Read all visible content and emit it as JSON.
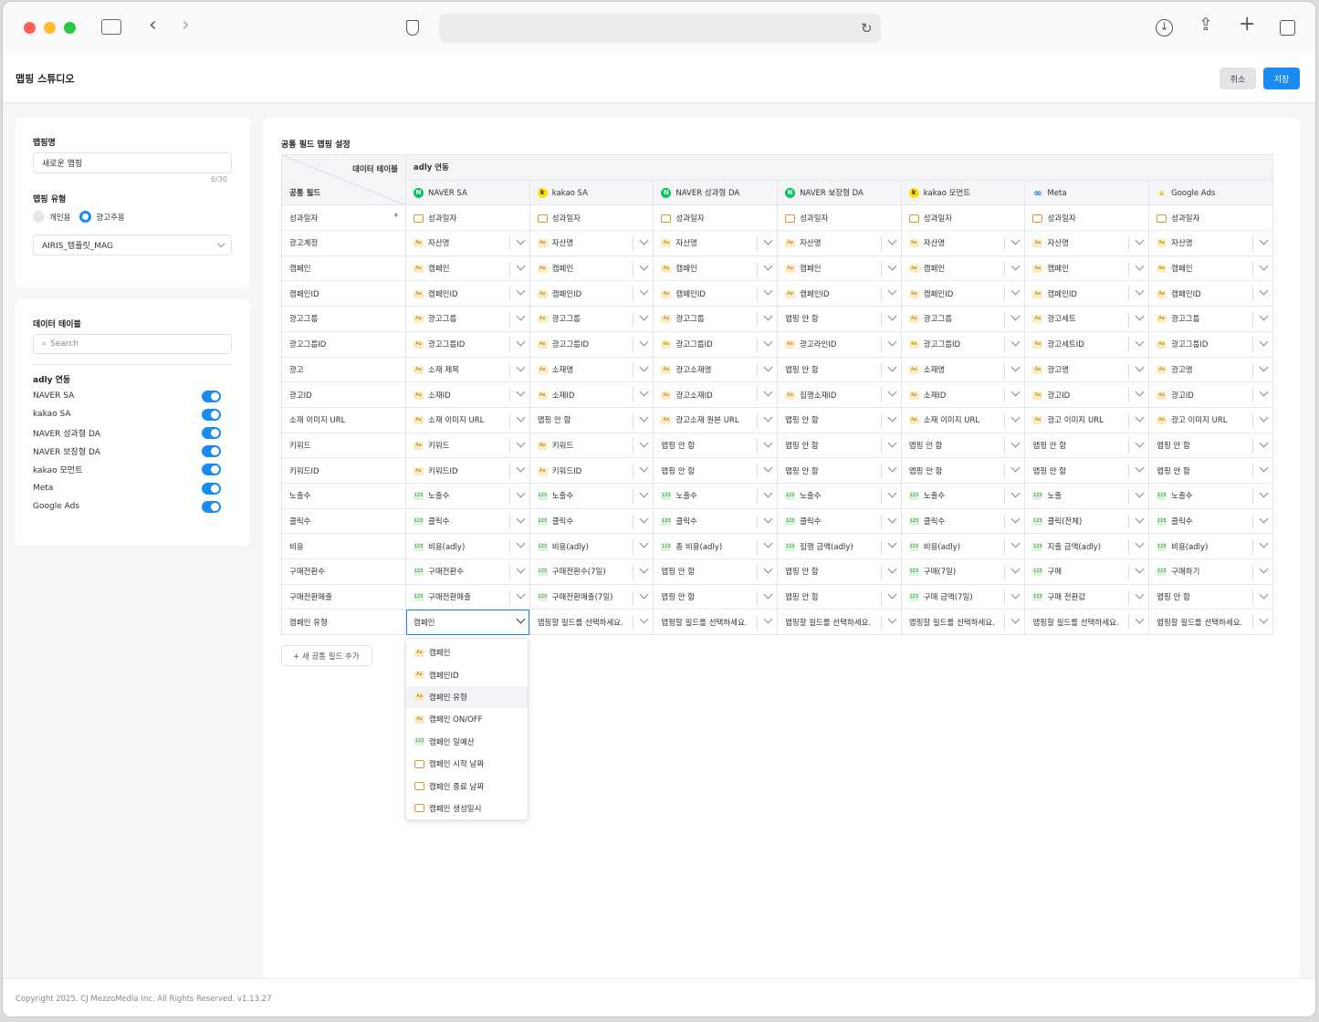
{
  "app": {
    "title": "맵핑 스튜디오",
    "cancel_label": "취소",
    "save_label": "저장",
    "footer": "Copyright 2025. CJ MezzoMedia Inc. All Rights Reserved. v1.13.27"
  },
  "colors": {
    "accent": "#1a8cf0",
    "panel_bg": "#ffffff",
    "page_bg": "#f5f6f8"
  },
  "mapping_panel": {
    "name_label": "맵핑명",
    "name_value": "새로운 맵핑",
    "char_count": "6/30",
    "type_label": "맵핑 유형",
    "type_options": [
      "개인용",
      "광고주용"
    ],
    "type_selected": "광고주용",
    "advertiser_value": "AIRIS_템플릿_MAG"
  },
  "data_table_panel": {
    "label": "데이터 테이블",
    "search_placeholder": "Search",
    "group_label": "adly 연동",
    "sources": [
      {
        "name": "NAVER SA",
        "enabled": true
      },
      {
        "name": "kakao SA",
        "enabled": true
      },
      {
        "name": "NAVER 성과형 DA",
        "enabled": true
      },
      {
        "name": "NAVER 보장형 DA",
        "enabled": true
      },
      {
        "name": "kakao 모먼트",
        "enabled": true
      },
      {
        "name": "Meta",
        "enabled": true
      },
      {
        "name": "Google Ads",
        "enabled": true
      }
    ]
  },
  "main": {
    "section_title": "공통 필드 맵핑 설정",
    "corner_top": "데이터 테이블",
    "corner_bottom": "공통 필드",
    "group_header": "adly 연동",
    "columns": [
      {
        "name": "NAVER SA",
        "icon": "naver-logo-icon"
      },
      {
        "name": "kakao SA",
        "icon": "kakao-logo-icon"
      },
      {
        "name": "NAVER 성과형 DA",
        "icon": "naver-logo-icon"
      },
      {
        "name": "NAVER 보장형 DA",
        "icon": "naver-logo-icon"
      },
      {
        "name": "kakao 모먼트",
        "icon": "kakao-logo-icon"
      },
      {
        "name": "Meta",
        "icon": "meta-logo-icon"
      },
      {
        "name": "Google Ads",
        "icon": "google-ads-logo-icon"
      }
    ],
    "rows": [
      {
        "field": "성과일자",
        "required": "*",
        "cells": [
          [
            "date",
            "성과일자"
          ],
          [
            "date",
            "성과일자"
          ],
          [
            "date",
            "성과일자"
          ],
          [
            "date",
            "성과일자"
          ],
          [
            "date",
            "성과일자"
          ],
          [
            "date",
            "성과일자"
          ],
          [
            "date",
            "성과일자"
          ]
        ]
      },
      {
        "field": "광고계정",
        "cells": [
          [
            "text",
            "자산명"
          ],
          [
            "text",
            "자산명"
          ],
          [
            "text",
            "자산명"
          ],
          [
            "text",
            "자산명"
          ],
          [
            "text",
            "자산명"
          ],
          [
            "text",
            "자산명"
          ],
          [
            "text",
            "자산명"
          ]
        ]
      },
      {
        "field": "캠페인",
        "cells": [
          [
            "text",
            "캠페인"
          ],
          [
            "text",
            "캠페인"
          ],
          [
            "text",
            "캠페인"
          ],
          [
            "text",
            "캠페인"
          ],
          [
            "text",
            "캠페인"
          ],
          [
            "text",
            "캠페인"
          ],
          [
            "text",
            "캠페인"
          ]
        ]
      },
      {
        "field": "캠페인ID",
        "cells": [
          [
            "text",
            "캠페인ID"
          ],
          [
            "text",
            "캠페인ID"
          ],
          [
            "text",
            "캠페인ID"
          ],
          [
            "text",
            "캠페인ID"
          ],
          [
            "text",
            "캠페인ID"
          ],
          [
            "text",
            "캠페인ID"
          ],
          [
            "text",
            "캠페인ID"
          ]
        ]
      },
      {
        "field": "광고그룹",
        "cells": [
          [
            "text",
            "광고그룹"
          ],
          [
            "text",
            "광고그룹"
          ],
          [
            "text",
            "광고그룹"
          ],
          [
            "none",
            "맵핑 안 함"
          ],
          [
            "text",
            "광고그룹"
          ],
          [
            "text",
            "광고세트"
          ],
          [
            "text",
            "광고그룹"
          ]
        ]
      },
      {
        "field": "광고그룹ID",
        "cells": [
          [
            "text",
            "광고그룹ID"
          ],
          [
            "text",
            "광고그룹ID"
          ],
          [
            "text",
            "광고그룹ID"
          ],
          [
            "text",
            "광고라인ID"
          ],
          [
            "text",
            "광고그룹ID"
          ],
          [
            "text",
            "광고세트ID"
          ],
          [
            "text",
            "광고그룹ID"
          ]
        ]
      },
      {
        "field": "광고",
        "cells": [
          [
            "text",
            "소재 제목"
          ],
          [
            "text",
            "소재명"
          ],
          [
            "text",
            "광고소재명"
          ],
          [
            "none",
            "맵핑 안 함"
          ],
          [
            "text",
            "소재명"
          ],
          [
            "text",
            "광고명"
          ],
          [
            "text",
            "광고명"
          ]
        ]
      },
      {
        "field": "광고ID",
        "cells": [
          [
            "text",
            "소재ID"
          ],
          [
            "text",
            "소재ID"
          ],
          [
            "text",
            "광고소재ID"
          ],
          [
            "text",
            "집행소재ID"
          ],
          [
            "text",
            "소재ID"
          ],
          [
            "text",
            "광고ID"
          ],
          [
            "text",
            "광고ID"
          ]
        ]
      },
      {
        "field": "소재 이미지 URL",
        "cells": [
          [
            "text",
            "소재 이미지 URL"
          ],
          [
            "none",
            "맵핑 안 함"
          ],
          [
            "text",
            "광고소재 원본 URL"
          ],
          [
            "none",
            "맵핑 안 함"
          ],
          [
            "text",
            "소재 이미지 URL"
          ],
          [
            "text",
            "광고 이미지 URL"
          ],
          [
            "text",
            "광고 이미지 URL"
          ]
        ]
      },
      {
        "field": "키워드",
        "cells": [
          [
            "text",
            "키워드"
          ],
          [
            "text",
            "키워드"
          ],
          [
            "none",
            "맵핑 안 함"
          ],
          [
            "none",
            "맵핑 안 함"
          ],
          [
            "none",
            "맵핑 안 함"
          ],
          [
            "none",
            "맵핑 안 함"
          ],
          [
            "none",
            "맵핑 안 함"
          ]
        ]
      },
      {
        "field": "키워드ID",
        "cells": [
          [
            "text",
            "키워드ID"
          ],
          [
            "text",
            "키워드ID"
          ],
          [
            "none",
            "맵핑 안 함"
          ],
          [
            "none",
            "맵핑 안 함"
          ],
          [
            "none",
            "맵핑 안 함"
          ],
          [
            "none",
            "맵핑 안 함"
          ],
          [
            "none",
            "맵핑 안 함"
          ]
        ]
      },
      {
        "field": "노출수",
        "cells": [
          [
            "num",
            "노출수"
          ],
          [
            "num",
            "노출수"
          ],
          [
            "num",
            "노출수"
          ],
          [
            "num",
            "노출수"
          ],
          [
            "num",
            "노출수"
          ],
          [
            "num",
            "노출"
          ],
          [
            "num",
            "노출수"
          ]
        ]
      },
      {
        "field": "클릭수",
        "cells": [
          [
            "num",
            "클릭수"
          ],
          [
            "num",
            "클릭수"
          ],
          [
            "num",
            "클릭수"
          ],
          [
            "num",
            "클릭수"
          ],
          [
            "num",
            "클릭수"
          ],
          [
            "num",
            "클릭(전체)"
          ],
          [
            "num",
            "클릭수"
          ]
        ]
      },
      {
        "field": "비용",
        "cells": [
          [
            "num",
            "비용(adly)"
          ],
          [
            "num",
            "비용(adly)"
          ],
          [
            "num",
            "총 비용(adly)"
          ],
          [
            "num",
            "집행 금액(adly)"
          ],
          [
            "num",
            "비용(adly)"
          ],
          [
            "num",
            "지출 금액(adly)"
          ],
          [
            "num",
            "비용(adly)"
          ]
        ]
      },
      {
        "field": "구매전환수",
        "cells": [
          [
            "num",
            "구매전환수"
          ],
          [
            "num",
            "구매전환수(7일)"
          ],
          [
            "none",
            "맵핑 안 함"
          ],
          [
            "none",
            "맵핑 안 함"
          ],
          [
            "num",
            "구매(7일)"
          ],
          [
            "num",
            "구매"
          ],
          [
            "num",
            "구매하기"
          ]
        ]
      },
      {
        "field": "구매전환매출",
        "cells": [
          [
            "num",
            "구매전환매출"
          ],
          [
            "num",
            "구매전환매출(7일)"
          ],
          [
            "none",
            "맵핑 안 함"
          ],
          [
            "none",
            "맵핑 안 함"
          ],
          [
            "num",
            "구매 금액(7일)"
          ],
          [
            "num",
            "구매 전환값"
          ],
          [
            "none",
            "맵핑 안 함"
          ]
        ]
      },
      {
        "field": "캠페인 유형",
        "cells": [
          [
            "active",
            "캠페인"
          ],
          [
            "none",
            "맵핑할 필드를 선택하세요."
          ],
          [
            "none",
            "맵핑할 필드를 선택하세요."
          ],
          [
            "none",
            "맵핑할 필드를 선택하세요."
          ],
          [
            "none",
            "맵핑할 필드를 선택하세요."
          ],
          [
            "none",
            "맵핑할 필드를 선택하세요."
          ],
          [
            "none",
            "맵핑할 필드를 선택하세요."
          ]
        ]
      }
    ],
    "add_field_label": "+ 새 공통 필드 추가",
    "dropdown_items": [
      {
        "type": "text",
        "label": "캠페인"
      },
      {
        "type": "text",
        "label": "캠페인ID"
      },
      {
        "type": "text",
        "label": "캠페인 유형"
      },
      {
        "type": "text",
        "label": "캠페인 ON/OFF"
      },
      {
        "type": "num",
        "label": "캠페인 일예산"
      },
      {
        "type": "date",
        "label": "캠페인 시작 날짜"
      },
      {
        "type": "date",
        "label": "캠페인 종료 날짜"
      },
      {
        "type": "date",
        "label": "캠페인 생성일시"
      }
    ],
    "badge_text": {
      "text": "Aa",
      "num": "123"
    }
  }
}
